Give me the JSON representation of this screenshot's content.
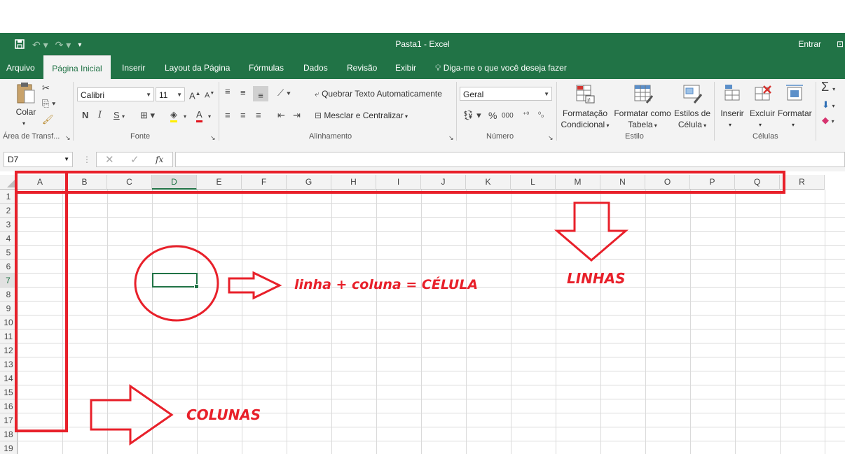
{
  "window": {
    "title": "Pasta1 - Excel",
    "signin": "Entrar"
  },
  "tabs": [
    {
      "label": "Arquivo"
    },
    {
      "label": "Página Inicial"
    },
    {
      "label": "Inserir"
    },
    {
      "label": "Layout da Página"
    },
    {
      "label": "Fórmulas"
    },
    {
      "label": "Dados"
    },
    {
      "label": "Revisão"
    },
    {
      "label": "Exibir"
    },
    {
      "label": "Diga-me o que você deseja fazer"
    }
  ],
  "ribbon": {
    "clipboard": {
      "paste_label": "Colar",
      "group_label": "Área de Transf..."
    },
    "font": {
      "name": "Calibri",
      "size": "11",
      "bold": "N",
      "italic": "I",
      "underline": "S",
      "group_label": "Fonte"
    },
    "alignment": {
      "wrap_label": "Quebrar Texto Automaticamente",
      "merge_label": "Mesclar e Centralizar",
      "group_label": "Alinhamento"
    },
    "number": {
      "format": "Geral",
      "percent": "%",
      "thousands": "000",
      "group_label": "Número"
    },
    "styles": {
      "conditional_1": "Formatação",
      "conditional_2": "Condicional",
      "table_1": "Formatar como",
      "table_2": "Tabela",
      "cell_1": "Estilos de",
      "cell_2": "Célula",
      "group_label": "Estilo"
    },
    "cells": {
      "insert": "Inserir",
      "delete": "Excluir",
      "format": "Formatar",
      "group_label": "Células"
    }
  },
  "formula_bar": {
    "name_box": "D7",
    "fx": "fx",
    "value": ""
  },
  "sheet": {
    "columns": [
      "A",
      "B",
      "C",
      "D",
      "E",
      "F",
      "G",
      "H",
      "I",
      "J",
      "K",
      "L",
      "M",
      "N",
      "O",
      "P",
      "Q",
      "R"
    ],
    "rows": [
      "1",
      "2",
      "3",
      "4",
      "5",
      "6",
      "7",
      "8",
      "9",
      "10",
      "11",
      "12",
      "13",
      "14",
      "15",
      "16",
      "17",
      "18",
      "19"
    ],
    "selected_column": "D",
    "selected_row": "7"
  },
  "annotations": {
    "cell_text": "linha + coluna = CÉLULA",
    "rows_text": "LINHAS",
    "columns_text": "COLUNAS",
    "color": "#e8202a"
  },
  "colors": {
    "excel_green": "#217346",
    "ribbon_bg": "#f3f3f3"
  }
}
